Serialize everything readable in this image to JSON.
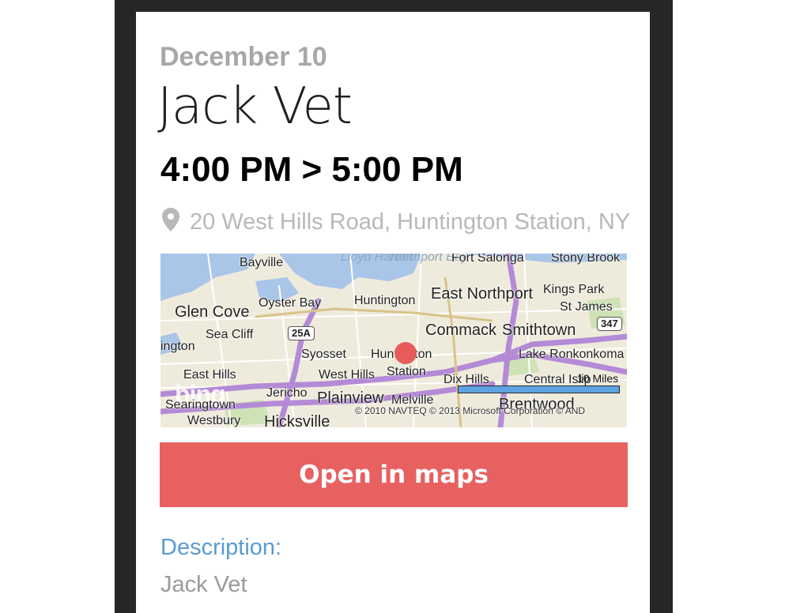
{
  "event": {
    "date": "December 10",
    "title": "Jack Vet",
    "time_range": "4:00 PM > 5:00 PM",
    "address": "20 West Hills Road, Huntington Station, NY"
  },
  "map": {
    "labels": [
      {
        "text": "Bayville"
      },
      {
        "text": "Lloyd Harbor"
      },
      {
        "text": "Northport Bay"
      },
      {
        "text": "Fort Salonga"
      },
      {
        "text": "Stony Brook"
      },
      {
        "text": "Glen Cove"
      },
      {
        "text": "Oyster Bay"
      },
      {
        "text": "Huntington"
      },
      {
        "text": "East Northport"
      },
      {
        "text": "Kings Park"
      },
      {
        "text": "St James"
      },
      {
        "text": "Sea Cliff"
      },
      {
        "text": "Commack"
      },
      {
        "text": "Smithtown"
      },
      {
        "text": "ington"
      },
      {
        "text": "Syosset"
      },
      {
        "text": "Huntington"
      },
      {
        "text": "Lake Ronkonkoma"
      },
      {
        "text": "East Hills"
      },
      {
        "text": "West Hills"
      },
      {
        "text": "Station"
      },
      {
        "text": "Dix Hills"
      },
      {
        "text": "Central Islip"
      },
      {
        "text": "Jericho"
      },
      {
        "text": "Plainview"
      },
      {
        "text": "Melville"
      },
      {
        "text": "Brentwood"
      },
      {
        "text": "Searingtown"
      },
      {
        "text": "Westbury"
      },
      {
        "text": "Hicksville"
      }
    ],
    "shields": [
      "25A",
      "347"
    ],
    "scale_label": "10 Miles",
    "copyright": "© 2010 NAVTEQ   © 2013 Microsoft Corporation   © AND",
    "brand": "bing"
  },
  "actions": {
    "open_in_maps": "Open in maps"
  },
  "description": {
    "label": "Description:",
    "value": "Jack Vet"
  },
  "colors": {
    "accent": "#e86161",
    "link": "#5a9bd5",
    "frame": "#262626"
  },
  "icons": {
    "location": "map-pin-icon"
  }
}
